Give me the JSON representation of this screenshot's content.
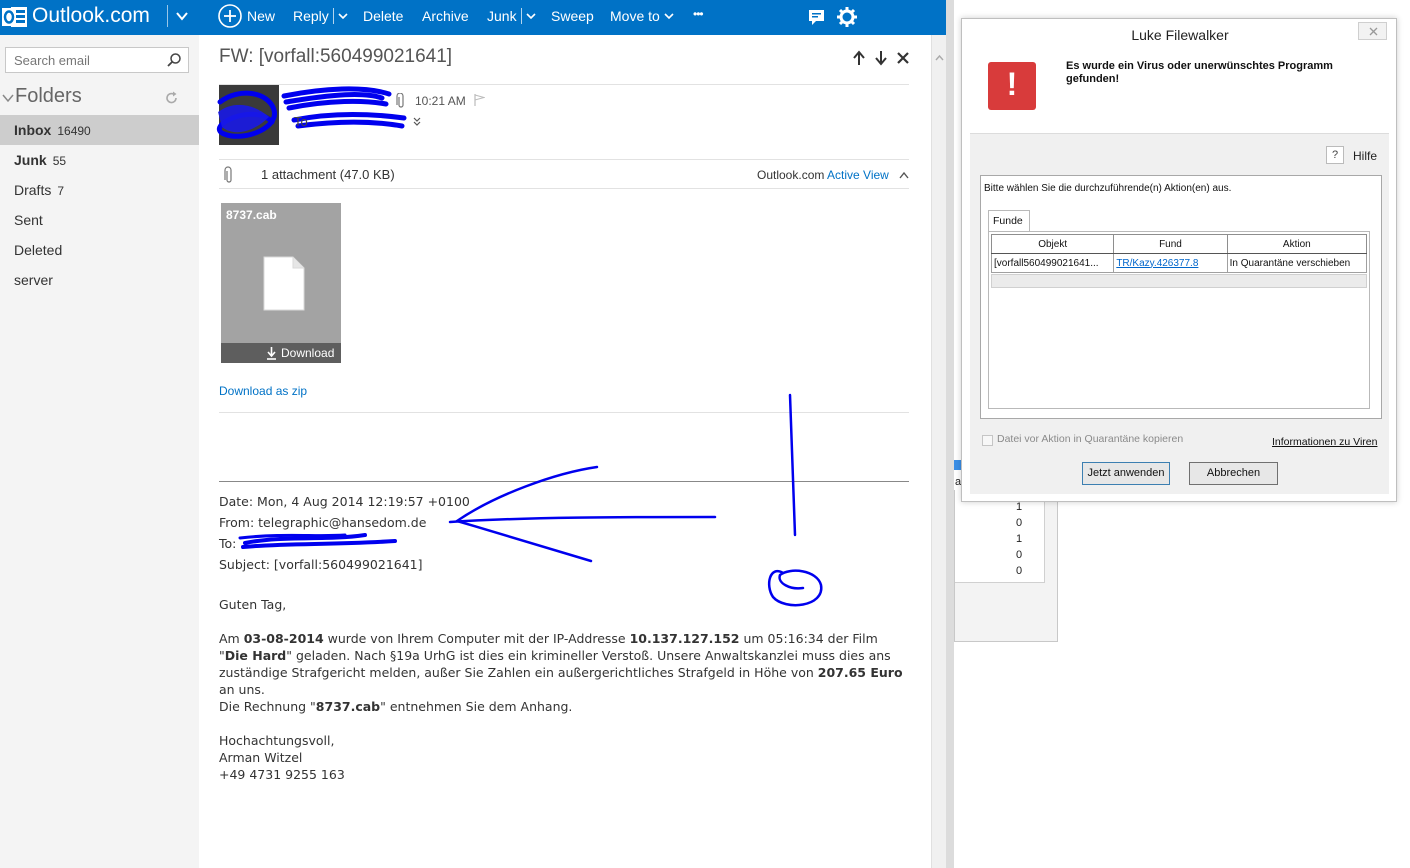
{
  "app": {
    "brand": "Outlook.com",
    "toolbar": {
      "new": "New",
      "reply": "Reply",
      "delete": "Delete",
      "archive": "Archive",
      "junk": "Junk",
      "sweep": "Sweep",
      "move_to": "Move to",
      "more": "•••"
    },
    "colors": {
      "brand_blue": "#0072c6",
      "nav_bg": "#f4f4f4",
      "selected": "#cdcdcd",
      "error_red": "#d83b3b"
    }
  },
  "sidebar": {
    "search_placeholder": "Search email",
    "folders_title": "Folders",
    "folders": [
      {
        "label": "Inbox",
        "count": "16490"
      },
      {
        "label": "Junk",
        "count": "55"
      },
      {
        "label": "Drafts",
        "count": "7"
      },
      {
        "label": "Sent",
        "count": ""
      },
      {
        "label": "Deleted",
        "count": ""
      },
      {
        "label": "server",
        "count": ""
      }
    ]
  },
  "message": {
    "subject": "FW: [vorfall:560499021641]",
    "time": "10:21 AM",
    "to_label": "To",
    "attachment_summary": "1 attachment (47.0 KB)",
    "active_view_brand": "Outlook.com",
    "active_view_link": "Active View",
    "attachment": {
      "name": "8737.cab",
      "download_label": "Download"
    },
    "download_zip": "Download as zip",
    "forward_header": {
      "date": "Date: Mon, 4 Aug 2014 12:19:57 +0100",
      "from": "From: telegraphic@hansedom.de",
      "to": "To:",
      "subject": "Subject: [vorfall:560499021641]"
    },
    "body": {
      "greeting": "Guten Tag,",
      "p1_a": "Am ",
      "date": "03-08-2014",
      "p1_b": " wurde von Ihrem Computer mit der IP-Addresse ",
      "ip": "10.137.127.152",
      "p1_c": " um 05:16:34 der Film",
      "p2_a": "\"",
      "film": "Die Hard",
      "p2_b": "\" geladen. Nach §19a UrhG ist dies ein krimineller Verstoß. Unsere Anwaltskanzlei muss dies ans",
      "p3": "zuständige Strafgericht melden, außer Sie Zahlen ein außergerichtliches Strafgeld in Höhe von ",
      "amount": "207.65 Euro",
      "p4": "an uns.",
      "p5_a": "Die Rechnung \"",
      "file": "8737.cab",
      "p5_b": "\" entnehmen Sie dem Anhang.",
      "closing": "Hochachtungsvoll,",
      "signature_name": "Arman Witzel",
      "signature_phone": "+49 4731 9255 163"
    }
  },
  "background_window": {
    "a_char": "a",
    "numbers": [
      "1",
      "0",
      "1",
      "0",
      "0"
    ]
  },
  "dialog": {
    "title": "Luke Filewalker",
    "close": "✕",
    "error_glyph": "!",
    "message": "Es wurde ein Virus oder unerwünschtes Programm gefunden!",
    "help_q": "?",
    "help": "Hilfe",
    "prompt": "Bitte wählen Sie die durchzuführende(n) Aktion(en) aus.",
    "tab": "Funde",
    "columns": [
      "Objekt",
      "Fund",
      "Aktion"
    ],
    "row": {
      "objekt": "[vorfall560499021641...",
      "fund": "TR/Kazy.426377.8",
      "aktion": "In Quarantäne verschieben"
    },
    "checkbox_label": "Datei vor Aktion in Quarantäne kopieren",
    "info_link": "Informationen zu Viren",
    "apply_button": "Jetzt anwenden",
    "cancel_button": "Abbrechen"
  }
}
